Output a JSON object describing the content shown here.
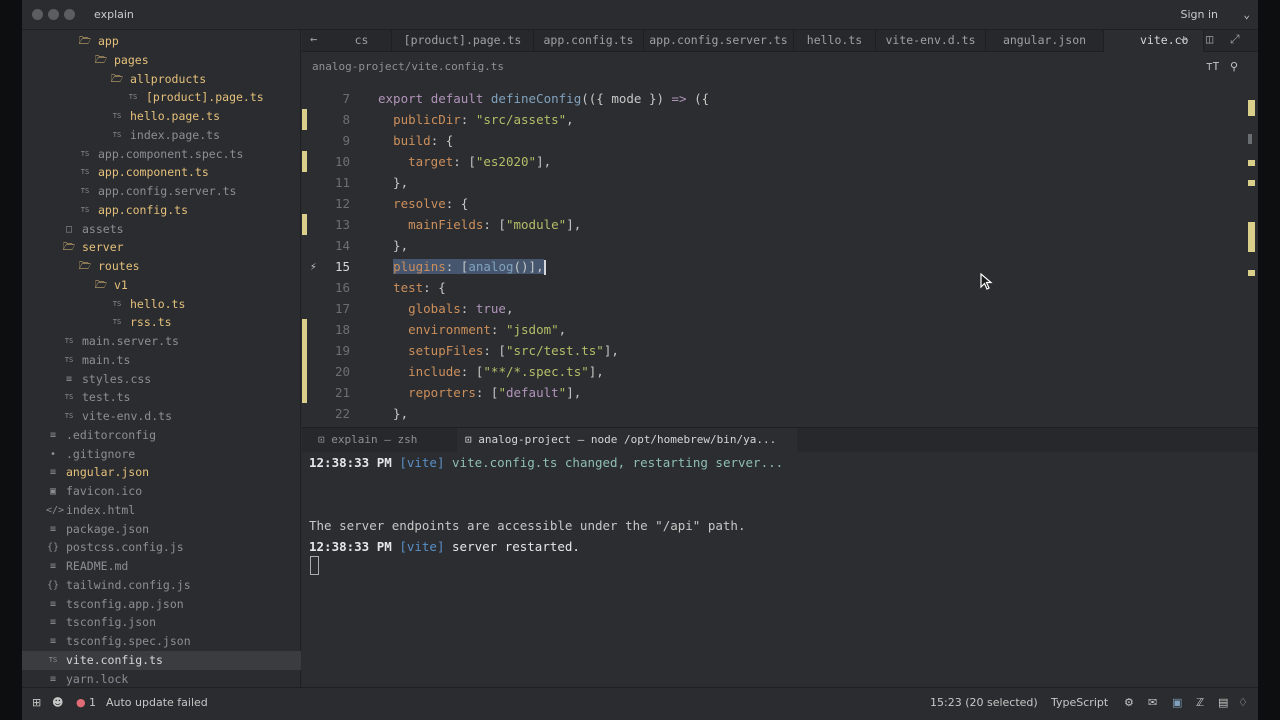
{
  "window": {
    "title": "explain",
    "sign_in": "Sign in"
  },
  "sidebar": {
    "items": [
      {
        "label": "app",
        "kind": "folder",
        "icon": "folder-icon"
      },
      {
        "label": "pages",
        "kind": "folder",
        "icon": "folder-icon"
      },
      {
        "label": "allproducts",
        "kind": "folder",
        "icon": "folder-icon"
      },
      {
        "label": "[product].page.ts",
        "kind": "modified",
        "icon": "typescript-file-icon"
      },
      {
        "label": "hello.page.ts",
        "kind": "modified",
        "icon": "typescript-file-icon"
      },
      {
        "label": "index.page.ts",
        "kind": "file",
        "icon": "typescript-file-icon"
      },
      {
        "label": "app.component.spec.ts",
        "kind": "file",
        "icon": "typescript-file-icon"
      },
      {
        "label": "app.component.ts",
        "kind": "modified",
        "icon": "typescript-file-icon"
      },
      {
        "label": "app.config.server.ts",
        "kind": "file",
        "icon": "typescript-file-icon"
      },
      {
        "label": "app.config.ts",
        "kind": "modified",
        "icon": "typescript-file-icon"
      },
      {
        "label": "assets",
        "kind": "file",
        "icon": "folder-closed-icon"
      },
      {
        "label": "server",
        "kind": "folder",
        "icon": "folder-icon"
      },
      {
        "label": "routes",
        "kind": "folder",
        "icon": "folder-icon"
      },
      {
        "label": "v1",
        "kind": "folder",
        "icon": "folder-icon"
      },
      {
        "label": "hello.ts",
        "kind": "modified",
        "icon": "typescript-file-icon"
      },
      {
        "label": "rss.ts",
        "kind": "modified",
        "icon": "typescript-file-icon"
      },
      {
        "label": "main.server.ts",
        "kind": "file",
        "icon": "typescript-file-icon"
      },
      {
        "label": "main.ts",
        "kind": "file",
        "icon": "typescript-file-icon"
      },
      {
        "label": "styles.css",
        "kind": "file",
        "icon": "css-file-icon"
      },
      {
        "label": "test.ts",
        "kind": "file",
        "icon": "typescript-file-icon"
      },
      {
        "label": "vite-env.d.ts",
        "kind": "file",
        "icon": "typescript-file-icon"
      },
      {
        "label": ".editorconfig",
        "kind": "file",
        "icon": "config-file-icon"
      },
      {
        "label": ".gitignore",
        "kind": "file",
        "icon": "git-file-icon"
      },
      {
        "label": "angular.json",
        "kind": "modified",
        "icon": "json-file-icon"
      },
      {
        "label": "favicon.ico",
        "kind": "file",
        "icon": "image-file-icon"
      },
      {
        "label": "index.html",
        "kind": "file",
        "icon": "html-file-icon"
      },
      {
        "label": "package.json",
        "kind": "file",
        "icon": "json-file-icon"
      },
      {
        "label": "postcss.config.js",
        "kind": "file",
        "icon": "js-file-icon"
      },
      {
        "label": "README.md",
        "kind": "file",
        "icon": "markdown-file-icon"
      },
      {
        "label": "tailwind.config.js",
        "kind": "file",
        "icon": "js-file-icon"
      },
      {
        "label": "tsconfig.app.json",
        "kind": "file",
        "icon": "json-file-icon"
      },
      {
        "label": "tsconfig.json",
        "kind": "file",
        "icon": "json-file-icon"
      },
      {
        "label": "tsconfig.spec.json",
        "kind": "file",
        "icon": "json-file-icon"
      },
      {
        "label": "vite.config.ts",
        "kind": "selected",
        "icon": "typescript-file-icon"
      },
      {
        "label": "yarn.lock",
        "kind": "file",
        "icon": "lock-file-icon"
      }
    ]
  },
  "tabs": [
    {
      "label": "cs"
    },
    {
      "label": "[product].page.ts"
    },
    {
      "label": "app.config.ts"
    },
    {
      "label": "app.config.server.ts"
    },
    {
      "label": "hello.ts"
    },
    {
      "label": "vite-env.d.ts"
    },
    {
      "label": "angular.json"
    },
    {
      "label": "vite.co"
    }
  ],
  "editor": {
    "breadcrumb": "analog-project/vite.config.ts",
    "lines": [
      {
        "num": "7",
        "text": "export default defineConfig(({ mode }) => ({"
      },
      {
        "num": "8",
        "text": "  publicDir: \"src/assets\","
      },
      {
        "num": "9",
        "text": "  build: {"
      },
      {
        "num": "10",
        "text": "    target: [\"es2020\"],"
      },
      {
        "num": "11",
        "text": "  },"
      },
      {
        "num": "12",
        "text": "  resolve: {"
      },
      {
        "num": "13",
        "text": "    mainFields: [\"module\"],"
      },
      {
        "num": "14",
        "text": "  },"
      },
      {
        "num": "15",
        "text": "  plugins: [analog()],"
      },
      {
        "num": "16",
        "text": "  test: {"
      },
      {
        "num": "17",
        "text": "    globals: true,"
      },
      {
        "num": "18",
        "text": "    environment: \"jsdom\","
      },
      {
        "num": "19",
        "text": "    setupFiles: [\"src/test.ts\"],"
      },
      {
        "num": "20",
        "text": "    include: [\"**/*.spec.ts\"],"
      },
      {
        "num": "21",
        "text": "    reporters: [\"default\"],"
      },
      {
        "num": "22",
        "text": "  },"
      }
    ]
  },
  "terminal": {
    "tabs": [
      {
        "label": "explain — zsh"
      },
      {
        "label": "analog-project — node /opt/homebrew/bin/ya..."
      }
    ],
    "lines": {
      "l1_time": "12:38:33 PM",
      "l1_vite": "[vite]",
      "l1_msg": "vite.config.ts changed, restarting server...",
      "l2": "The server endpoints are accessible under the \"/api\" path.",
      "l3_time": "12:38:33 PM",
      "l3_vite": "[vite]",
      "l3_msg": "server restarted."
    }
  },
  "statusbar": {
    "error_count": "1",
    "message": "Auto update failed",
    "cursor_position": "15:23 (20 selected)",
    "language": "TypeScript"
  },
  "colors": {
    "modified_file": "#e5c07b",
    "keyword": "#b294bb",
    "function": "#81a2be",
    "property": "#cc8f5c",
    "string": "#b5bd68",
    "selection": "#45566e"
  }
}
